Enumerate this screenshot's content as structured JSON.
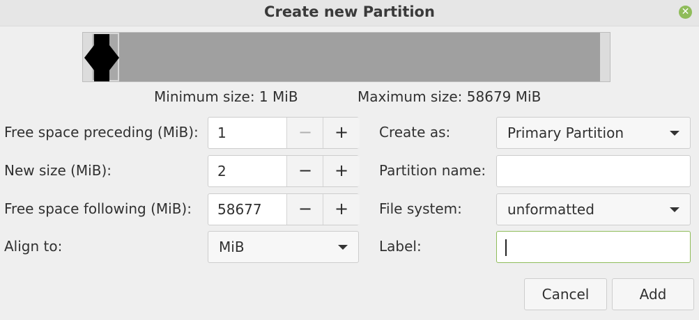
{
  "window": {
    "title": "Create new Partition"
  },
  "size_info": {
    "minimum": "Minimum size: 1 MiB",
    "maximum": "Maximum size: 58679 MiB"
  },
  "left_form": {
    "free_preceding": {
      "label": "Free space preceding (MiB):",
      "value": "1",
      "minus": "−",
      "plus": "+"
    },
    "new_size": {
      "label": "New size (MiB):",
      "value": "2",
      "minus": "−",
      "plus": "+"
    },
    "free_following": {
      "label": "Free space following (MiB):",
      "value": "58677",
      "minus": "−",
      "plus": "+"
    },
    "align_to": {
      "label": "Align to:",
      "value": "MiB"
    }
  },
  "right_form": {
    "create_as": {
      "label": "Create as:",
      "value": "Primary Partition"
    },
    "partition_name": {
      "label": "Partition name:",
      "value": ""
    },
    "file_system": {
      "label": "File system:",
      "value": "unformatted"
    },
    "fs_label": {
      "label": "Label:",
      "value": ""
    }
  },
  "buttons": {
    "cancel": "Cancel",
    "add": "Add"
  },
  "icons": {
    "close": "close-icon",
    "spin_minus": "minus-icon",
    "spin_plus": "plus-icon",
    "dropdown": "chevron-down-icon"
  },
  "colors": {
    "accent": "#8fbc5a",
    "bar_fill": "#a0a0a0",
    "handle": "#000000"
  }
}
